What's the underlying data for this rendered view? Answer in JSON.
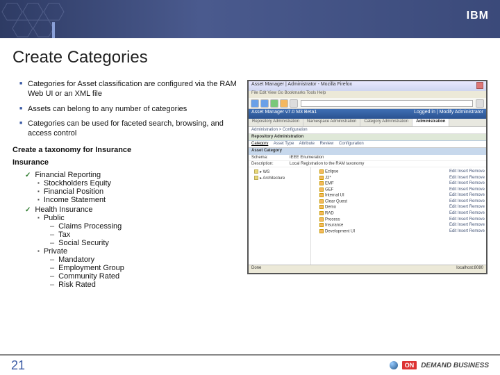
{
  "header": {
    "logo_text": "IBM"
  },
  "title": "Create Categories",
  "bullets": [
    "Categories for Asset classification are configured via the RAM Web UI or an XML file",
    "Assets can belong to any number of categories",
    "Categories can be used for faceted search, browsing, and access control"
  ],
  "taxonomy": {
    "heading": "Create a taxonomy for Insurance",
    "root": "Insurance",
    "children": [
      {
        "label": "Financial Reporting",
        "marker": "check",
        "children": [
          {
            "label": "Stockholders Equity",
            "marker": "box"
          },
          {
            "label": "Financial Position",
            "marker": "box"
          },
          {
            "label": "Income Statement",
            "marker": "box"
          }
        ]
      },
      {
        "label": "Health Insurance",
        "marker": "check",
        "children": [
          {
            "label": "Public",
            "marker": "box",
            "children": [
              {
                "label": "Claims Processing",
                "marker": "dash"
              },
              {
                "label": "Tax",
                "marker": "dash"
              },
              {
                "label": "Social Security",
                "marker": "dash"
              }
            ]
          },
          {
            "label": "Private",
            "marker": "box",
            "children": [
              {
                "label": "Mandatory",
                "marker": "dash"
              },
              {
                "label": "Employment Group",
                "marker": "dash"
              },
              {
                "label": "Community Rated",
                "marker": "dash"
              },
              {
                "label": "Risk Rated",
                "marker": "dash"
              }
            ]
          }
        ]
      }
    ]
  },
  "screenshot": {
    "window_title": "Asset Manager | Administrator - Mozilla Firefox",
    "menu": "File  Edit  View  Go  Bookmarks  Tools  Help",
    "app_title": "Asset Manager  v7.0 M3 Beta1",
    "login_info": "Logged in | Modify Administrator",
    "tabs": [
      "Repository Administration",
      "Namespace Administration",
      "Category Administration",
      "Administration"
    ],
    "active_tab_index": 3,
    "breadcrumb": "Administration > Configuration",
    "section": "Repository Administration",
    "subtabs": [
      "Category",
      "Asset Type",
      "Attribute",
      "Review",
      "Configuration"
    ],
    "active_subtab_index": 0,
    "panel_title": "Asset Category",
    "schema_rows": [
      {
        "label": "Schema:",
        "value": "IEEE Enumeration"
      },
      {
        "label": "Description:",
        "value": "Local Registration to the RAM taxonomy"
      }
    ],
    "left_tree": [
      "▸ WS",
      "▸ Architecture"
    ],
    "right_tree": [
      {
        "label": "Eclipse",
        "links": "Edit  Insert  Remove"
      },
      {
        "label": "J2*",
        "links": "Edit  Insert  Remove"
      },
      {
        "label": "EMF",
        "links": "Edit  Insert  Remove"
      },
      {
        "label": "GEF",
        "links": "Edit  Insert  Remove"
      },
      {
        "label": "Internal UI",
        "links": "Edit  Insert  Remove"
      },
      {
        "label": "Clear Quest",
        "links": "Edit  Insert  Remove"
      },
      {
        "label": "Demo",
        "links": "Edit  Insert  Remove"
      },
      {
        "label": "RAD",
        "links": "Edit  Insert  Remove"
      },
      {
        "label": "Process",
        "links": "Edit  Insert  Remove"
      },
      {
        "label": "Insurance",
        "links": "Edit  Insert  Remove"
      },
      {
        "label": "Development UI",
        "links": "Edit  Insert  Remove"
      }
    ],
    "status_left": "Done",
    "status_right": "localhost:8080"
  },
  "footer": {
    "page_number": "21",
    "brand_on": "ON",
    "brand_text": "DEMAND BUSINESS"
  }
}
